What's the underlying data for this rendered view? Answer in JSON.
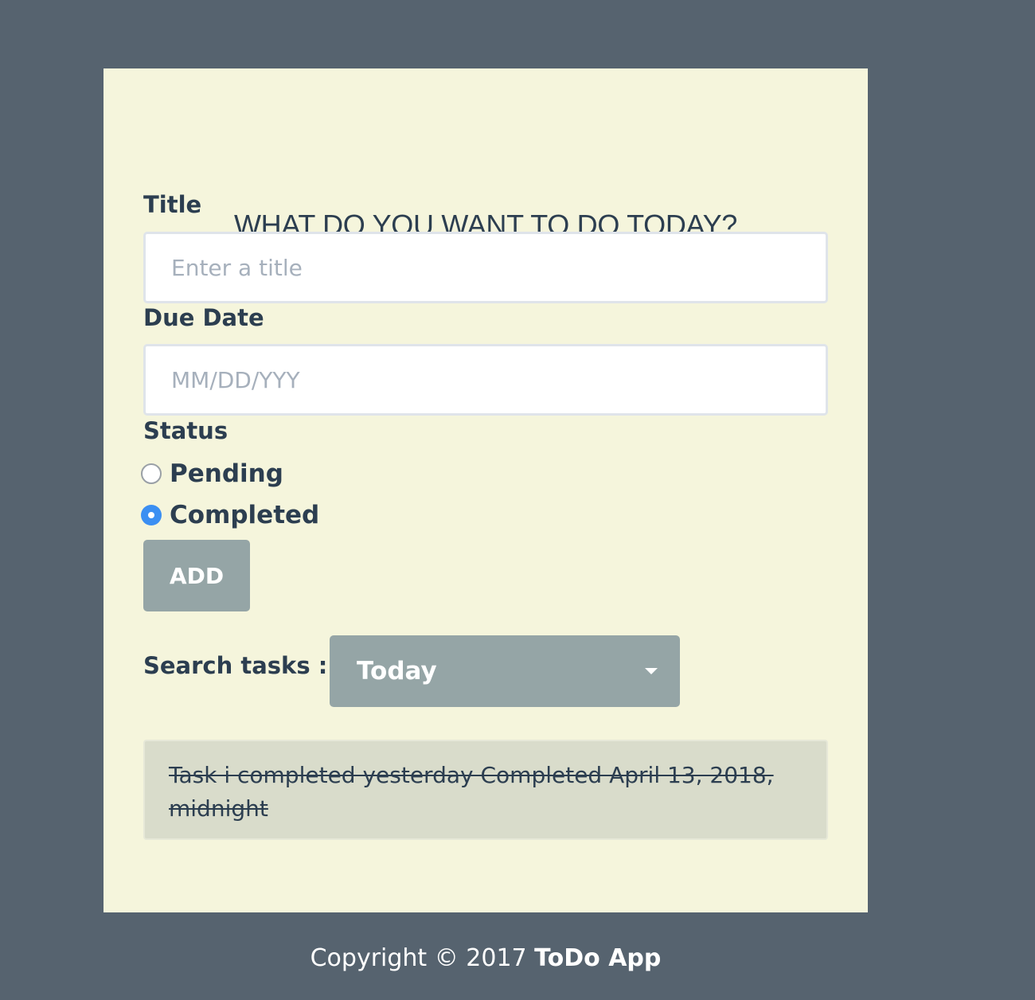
{
  "form": {
    "heading": "WHAT DO YOU WANT TO DO TODAY?",
    "title_label": "Title",
    "title_placeholder": "Enter a title",
    "due_date_label": "Due Date",
    "due_date_placeholder": "MM/DD/YYY",
    "status_label": "Status",
    "status_options": [
      {
        "label": "Pending",
        "selected": false
      },
      {
        "label": "Completed",
        "selected": true
      }
    ],
    "add_button_label": "ADD"
  },
  "search": {
    "label": "Search tasks :",
    "selected_option": "Today"
  },
  "tasks": [
    {
      "text": "Task i completed yesterday Completed April 13, 2018, midnight",
      "completed": true
    }
  ],
  "footer": {
    "prefix": "Copyright © 2017",
    "brand": "ToDo App"
  },
  "colors": {
    "page_background": "#56636f",
    "card_background": "#f5f5dc",
    "button_background": "#95a5a6",
    "radio_selected": "#3b8ff2",
    "text_dark": "#2c3e50"
  }
}
